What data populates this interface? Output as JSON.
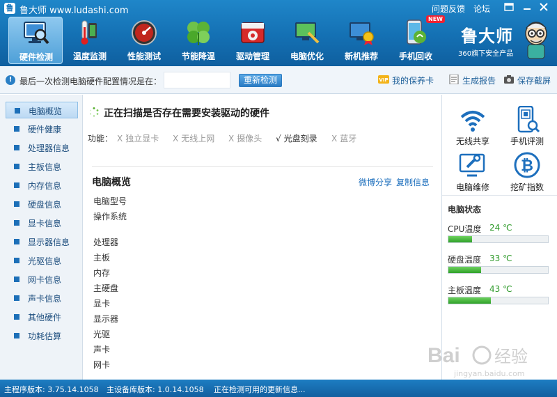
{
  "titlebar": {
    "title": "鲁大师 www.ludashi.com",
    "feedback": "问题反馈",
    "forum": "论坛"
  },
  "nav": {
    "items": [
      {
        "label": "硬件检测",
        "icon": "pc-magnifier-icon",
        "active": true
      },
      {
        "label": "温度监测",
        "icon": "thermometer-icon"
      },
      {
        "label": "性能测试",
        "icon": "speedometer-icon"
      },
      {
        "label": "节能降温",
        "icon": "leaf-icon"
      },
      {
        "label": "驱动管理",
        "icon": "gear-chip-icon"
      },
      {
        "label": "电脑优化",
        "icon": "monitor-broom-icon"
      },
      {
        "label": "新机推荐",
        "icon": "monitor-medal-icon"
      },
      {
        "label": "手机回收",
        "icon": "phone-recycle-icon",
        "badge": "NEW"
      }
    ]
  },
  "brand": {
    "name": "鲁大师",
    "sub": "360旗下安全产品"
  },
  "infobar": {
    "text": "最后一次检测电脑硬件配置情况是在：",
    "input_value": "",
    "rescan": "重新检测",
    "warranty": "我的保养卡",
    "report": "生成报告",
    "screenshot": "保存截屏",
    "vip_badge": "VIP"
  },
  "sidebar": {
    "items": [
      "电脑概览",
      "硬件健康",
      "处理器信息",
      "主板信息",
      "内存信息",
      "硬盘信息",
      "显卡信息",
      "显示器信息",
      "光驱信息",
      "网卡信息",
      "声卡信息",
      "其他硬件",
      "功耗估算"
    ],
    "active_index": 0
  },
  "main": {
    "scan_title": "正在扫描是否存在需要安装驱动的硬件",
    "func_label": "功能：",
    "functions": [
      {
        "label": "独立显卡",
        "mark": "X",
        "ok": false
      },
      {
        "label": "无线上网",
        "mark": "X",
        "ok": false
      },
      {
        "label": "摄像头",
        "mark": "X",
        "ok": false
      },
      {
        "label": "光盘刻录",
        "mark": "√",
        "ok": true
      },
      {
        "label": "蓝牙",
        "mark": "X",
        "ok": false
      }
    ],
    "section_title": "电脑概览",
    "share": "微博分享",
    "copy": "复制信息",
    "rows_a": [
      "电脑型号",
      "操作系统"
    ],
    "rows_b": [
      "处理器",
      "主板",
      "内存",
      "主硬盘",
      "显卡",
      "显示器",
      "光驱",
      "声卡",
      "网卡"
    ]
  },
  "right": {
    "tools": [
      {
        "label": "无线共享",
        "icon": "wifi-icon"
      },
      {
        "label": "手机评测",
        "icon": "phone-scan-icon"
      },
      {
        "label": "电脑维修",
        "icon": "monitor-wrench-icon"
      },
      {
        "label": "挖矿指数",
        "icon": "bitcoin-icon"
      }
    ],
    "status_title": "电脑状态",
    "temps": [
      {
        "label": "CPU温度",
        "value": "24 ℃",
        "level": 0.24
      },
      {
        "label": "硬盘温度",
        "value": "33 ℃",
        "level": 0.33
      },
      {
        "label": "主板温度",
        "value": "43 ℃",
        "level": 0.43
      }
    ]
  },
  "statusbar": {
    "main_version": "主程序版本: 3.75.14.1058",
    "db_version": "主设备库版本: 1.0.14.1058",
    "update": "正在检测可用的更新信息..."
  },
  "watermark": {
    "brand": "Bai",
    "cn": "经验",
    "url": "jingyan.baidu.com"
  },
  "colors": {
    "header": "#1470b3",
    "accent": "#1d6fbd",
    "temp_ok": "#2e9a2a"
  }
}
